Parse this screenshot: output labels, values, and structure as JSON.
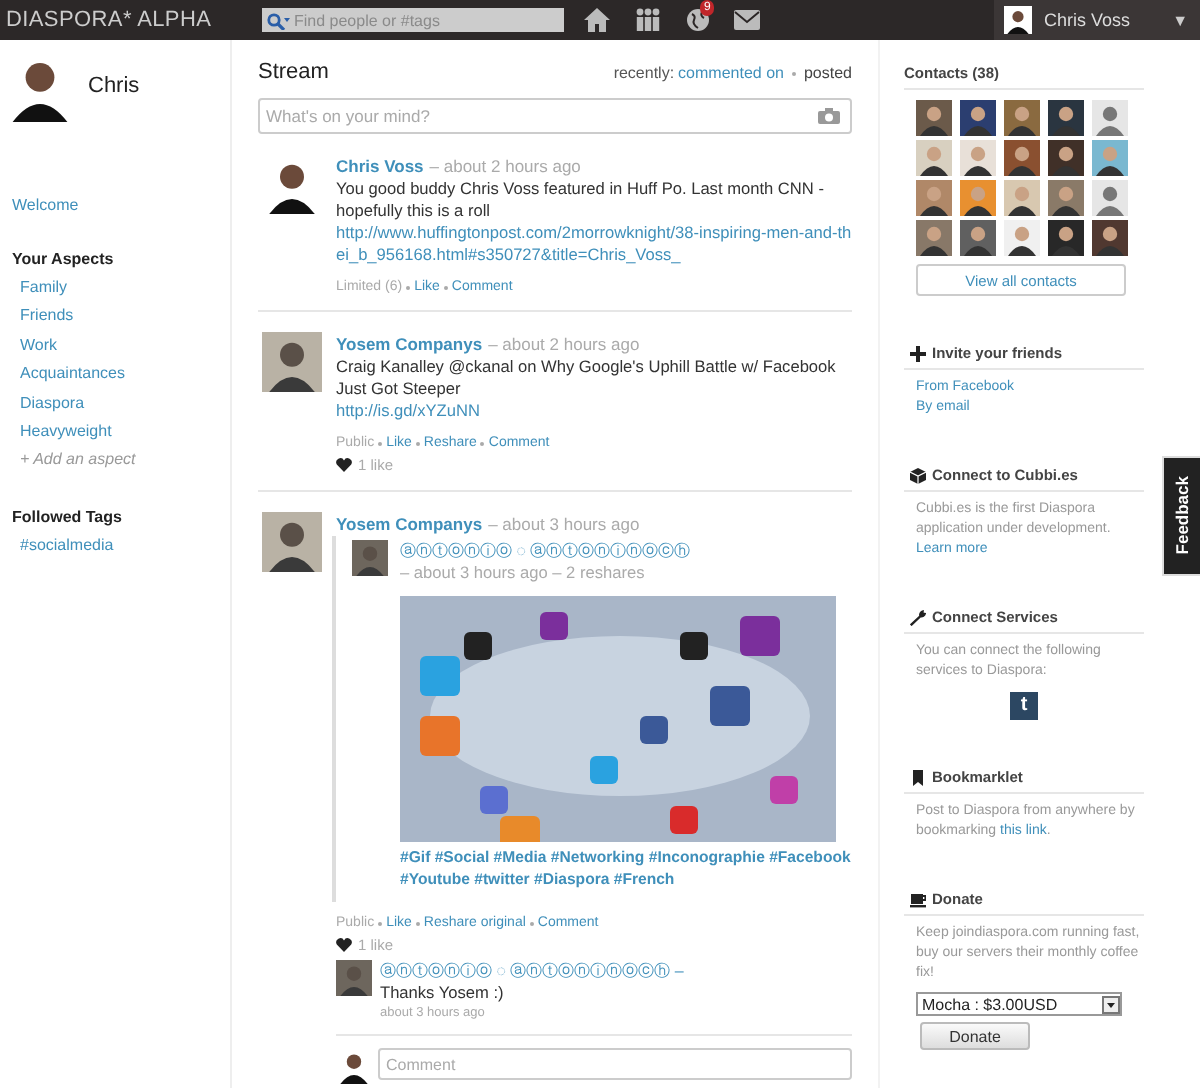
{
  "header": {
    "logo": "DIASPORA* ALPHA",
    "search": {
      "placeholder": "Find people or #tags"
    },
    "notification_count": "9",
    "user": "Chris Voss",
    "menu_caret": "▼"
  },
  "profile": {
    "name": "Chris"
  },
  "sidebar": {
    "welcome": "Welcome",
    "aspects_title": "Your Aspects",
    "aspects": [
      "Family",
      "Friends",
      "Work",
      "Acquaintances",
      "Diaspora",
      "Heavyweight"
    ],
    "add_aspect": "+ Add an aspect",
    "tags_title": "Followed Tags",
    "tags": [
      "#socialmedia"
    ]
  },
  "stream": {
    "title": "Stream",
    "sort_label": "recently:",
    "sort_options": [
      {
        "label": "commented on",
        "selected": false
      },
      {
        "label": "posted",
        "selected": true
      }
    ],
    "composer": {
      "placeholder": "What's on your mind?"
    },
    "posts": [
      {
        "author": "Chris Voss",
        "time": "– about 2 hours ago",
        "text": "You good buddy Chris Voss featured in Huff Po. Last month CNN - hopefully this is a roll ",
        "link": "http://www.huffingtonpost.com/2morrowknight/38-inspiring-men-and-thei_b_956168.html#s350727&title=Chris_Voss_",
        "visibility": "Limited (6)",
        "actions": [
          "Like",
          "Comment"
        ]
      },
      {
        "author": "Yosem Companys",
        "time": "– about 2 hours ago",
        "text": "Craig Kanalley @ckanal on Why Google's Uphill Battle w/ Facebook Just Got Steeper ",
        "link": "http://is.gd/xYZuNN",
        "visibility": "Public",
        "actions": [
          "Like",
          "Reshare",
          "Comment"
        ],
        "likes": "1 like"
      },
      {
        "author": "Yosem Companys",
        "time": "– about 3 hours ago",
        "reshare": {
          "author": "ⓐⓝⓣⓞⓝⓘⓞ ◌ ⓐⓝⓣⓞⓝⓘⓝⓞⓒⓗ",
          "time": "– about 3 hours ago – 2 reshares",
          "tags": "#Gif #Social #Media #Networking #Inconographie #Facebook #Youtube #twitter #Diaspora #French"
        },
        "visibility": "Public",
        "actions": [
          "Like",
          "Reshare original",
          "Comment"
        ],
        "likes": "1 like",
        "comments": [
          {
            "author": "ⓐⓝⓣⓞⓝⓘⓞ ◌ ⓐⓝⓣⓞⓝⓘⓝⓞⓒⓗ –",
            "text": "Thanks Yosem :)",
            "time": "about 3 hours ago"
          }
        ],
        "comment_box": {
          "placeholder": "Comment"
        }
      }
    ]
  },
  "contacts": {
    "title": "Contacts (38)",
    "avatars": [
      {
        "kind": "picture"
      },
      {
        "kind": "picture"
      },
      {
        "kind": "picture"
      },
      {
        "kind": "picture"
      },
      {
        "kind": "placeholder"
      },
      {
        "kind": "picture"
      },
      {
        "kind": "picture"
      },
      {
        "kind": "picture"
      },
      {
        "kind": "picture"
      },
      {
        "kind": "picture"
      },
      {
        "kind": "picture"
      },
      {
        "kind": "picture"
      },
      {
        "kind": "picture"
      },
      {
        "kind": "picture"
      },
      {
        "kind": "placeholder"
      },
      {
        "kind": "picture"
      },
      {
        "kind": "picture"
      },
      {
        "kind": "picture"
      },
      {
        "kind": "picture"
      },
      {
        "kind": "picture"
      }
    ],
    "button": "View all contacts"
  },
  "sections": [
    {
      "kind": "invite",
      "title": "Invite your friends",
      "links": [
        "From Facebook",
        "By email"
      ]
    },
    {
      "kind": "cubbies",
      "title": "Connect to Cubbi.es",
      "text": "Cubbi.es is the first Diaspora application under development.",
      "links": [
        "Learn more"
      ]
    },
    {
      "kind": "services",
      "title": "Connect Services",
      "text": "You can connect the following services to Diaspora:",
      "service_icon": "t"
    },
    {
      "kind": "bookmarklet",
      "title": "Bookmarklet",
      "text": "Post to Diaspora from anywhere by bookmarking ",
      "inline_link": "this link",
      "text_end": "."
    },
    {
      "kind": "donate",
      "title": "Donate",
      "text": "Keep joindiaspora.com running fast, buy our servers their monthly coffee fix!",
      "select": "Mocha : $3.00USD",
      "button": "Donate"
    }
  ],
  "feedback_tab": "Feedback"
}
